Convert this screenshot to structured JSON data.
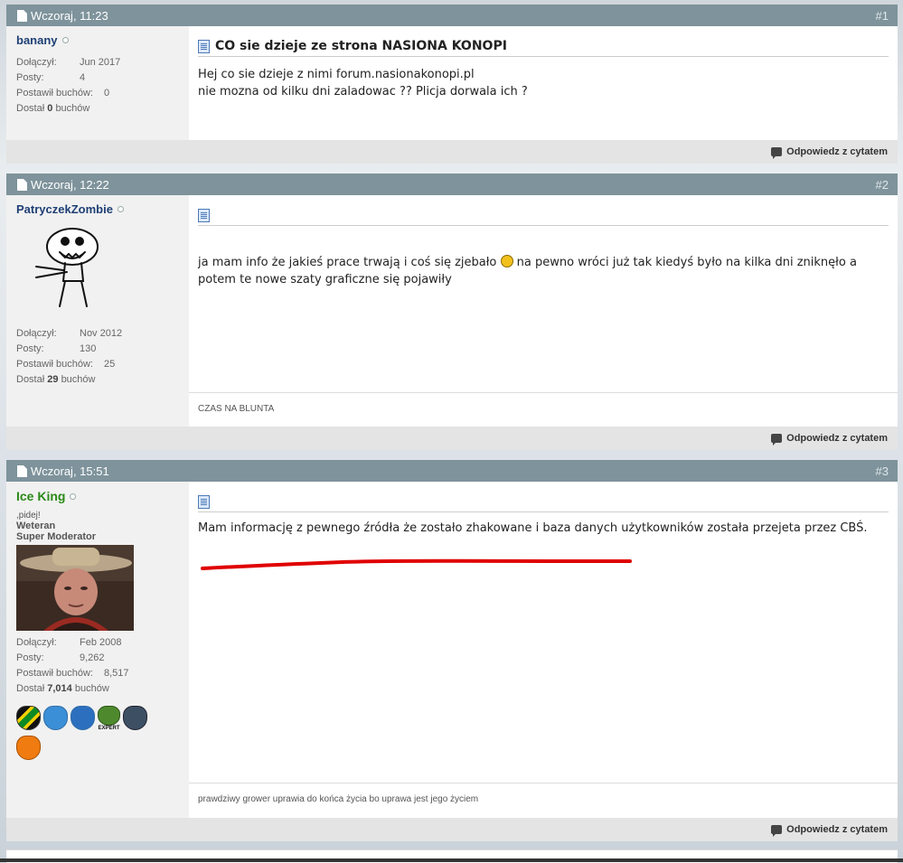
{
  "posts": [
    {
      "date": "Wczoraj, 11:23",
      "num": "#1",
      "user": {
        "name": "banany",
        "rows": [
          {
            "k": "Dołączył:",
            "v": "Jun 2017"
          },
          {
            "k": "Posty:",
            "v": "4"
          },
          {
            "k": "Postawił buchów:",
            "v": "0"
          }
        ],
        "got_prefix": "Dostał",
        "got_value": "0",
        "got_suffix": "buchów"
      },
      "title": "CO sie dzieje ze strona NASIONA KONOPI",
      "lines": [
        "Hej co sie dzieje z nimi forum.nasionakonopi.pl",
        "nie mozna od kilku dni zaladowac ?? Plicja dorwala ich ?"
      ],
      "reply_label": "Odpowiedz z cytatem"
    },
    {
      "date": "Wczoraj, 12:22",
      "num": "#2",
      "user": {
        "name": "PatryczekZombie",
        "rows": [
          {
            "k": "Dołączył:",
            "v": "Nov 2012"
          },
          {
            "k": "Posty:",
            "v": "130"
          },
          {
            "k": "Postawił buchów:",
            "v": "25"
          }
        ],
        "got_prefix": "Dostał",
        "got_value": "29",
        "got_suffix": "buchów"
      },
      "text_a": "ja mam info że jakieś prace trwają i coś się zjebało",
      "text_b": "na pewno wróci już tak kiedyś było na kilka dni zniknęło a potem te nowe szaty graficzne się pojawiły",
      "signature": "CZAS NA BLUNTA",
      "reply_label": "Odpowiedz z cytatem"
    },
    {
      "date": "Wczoraj, 15:51",
      "num": "#3",
      "user": {
        "name": "Ice King",
        "custom_title": ",pidej!",
        "rank1": "Weteran",
        "rank2": "Super Moderator",
        "rows": [
          {
            "k": "Dołączył:",
            "v": "Feb 2008"
          },
          {
            "k": "Posty:",
            "v": "9,262"
          },
          {
            "k": "Postawił buchów:",
            "v": "8,517"
          }
        ],
        "got_prefix": "Dostał",
        "got_value": "7,014",
        "got_suffix": "buchów",
        "badge_expert": "EXPERT"
      },
      "text": "Mam informację z pewnego źródła że zostało zhakowane i baza danych użytkowników została przejeta przez CBŚ.",
      "signature": "prawdziwy grower uprawia do końca życia bo uprawa jest jego życiem",
      "reply_label": "Odpowiedz z cytatem"
    }
  ],
  "colors": {
    "header_bg": "#7e939b",
    "username_blue": "#1e3f75",
    "username_green": "#2a8a17",
    "highlight_underline": "#e00000"
  }
}
